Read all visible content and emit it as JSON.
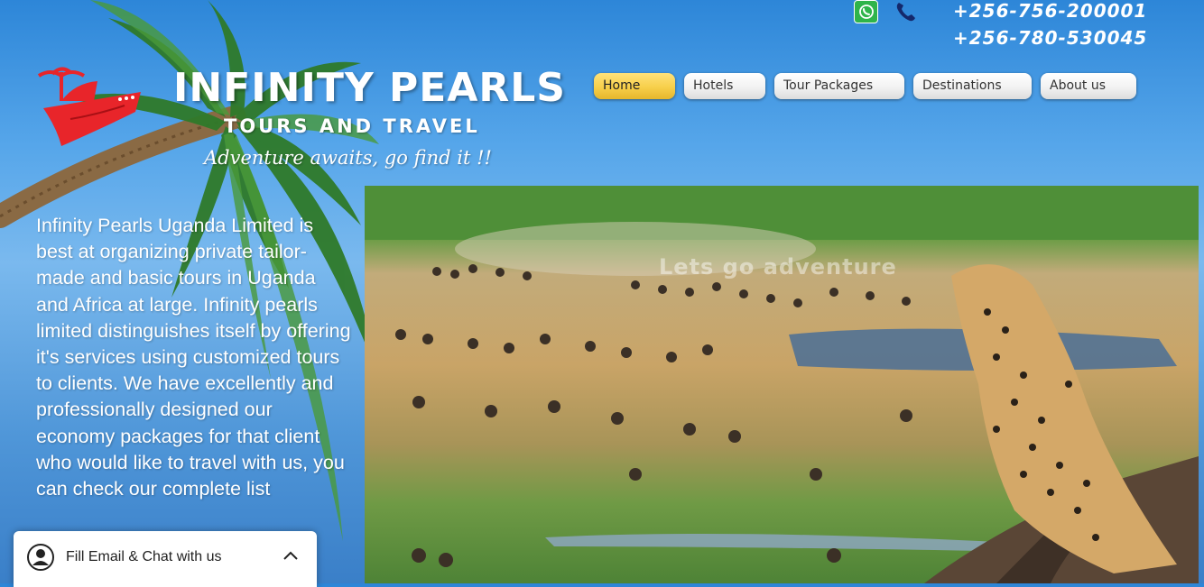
{
  "brand": {
    "title": "INFINITY PEARLS",
    "subtitle": "TOURS AND TRAVEL",
    "tagline": "Adventure awaits, go find it  !!"
  },
  "contacts": {
    "whatsapp_icon": "whatsapp-icon",
    "phone_icon": "phone-icon",
    "phone1": "+256-756-200001",
    "phone2": "+256-780-530045"
  },
  "nav": {
    "items": [
      {
        "label": "Home",
        "active": true
      },
      {
        "label": "Hotels"
      },
      {
        "label": "Tour Packages"
      },
      {
        "label": "Destinations"
      },
      {
        "label": "About us"
      }
    ]
  },
  "intro": {
    "text": "Infinity Pearls Uganda Limited is best at organizing private tailor-made and basic tours in Uganda and Africa at large. Infinity pearls limited distinguishes itself by offering it's services using customized tours to clients. We have excellently and professionally designed our economy packages for that client who would like to travel with us, you can check our complete list"
  },
  "hero": {
    "overlay_text": "Lets go adventure"
  },
  "chat": {
    "label": "Fill Email & Chat with us"
  },
  "colors": {
    "nav_active": "#f7cf4a",
    "logo_red": "#e8252a",
    "whatsapp_green": "#2fb44a"
  }
}
